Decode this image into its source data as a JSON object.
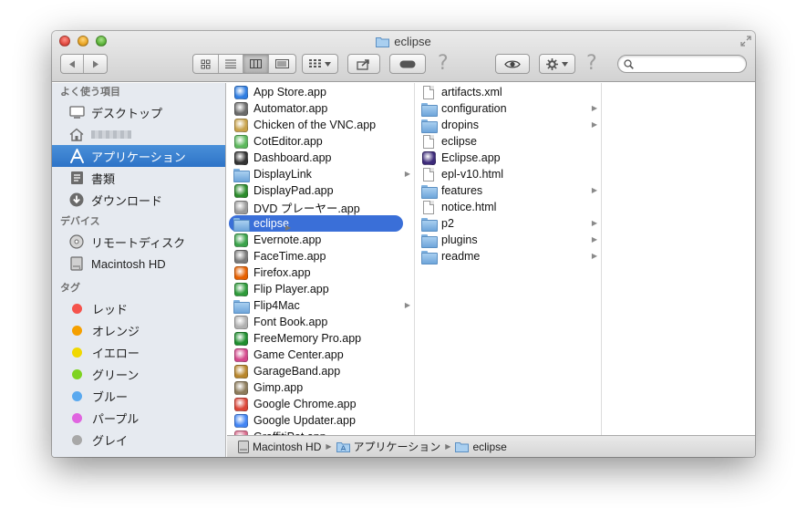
{
  "window": {
    "title": "eclipse"
  },
  "search": {
    "value": "",
    "placeholder": ""
  },
  "sidebar": {
    "sections": [
      {
        "title": "よく使う項目",
        "items": [
          {
            "label": "デスクトップ",
            "icon": "desktop-icon"
          },
          {
            "label": "",
            "icon": "home-icon",
            "blurred": true
          },
          {
            "label": "アプリケーション",
            "icon": "applications-icon",
            "selected": true
          },
          {
            "label": "書類",
            "icon": "documents-icon"
          },
          {
            "label": "ダウンロード",
            "icon": "downloads-icon"
          }
        ]
      },
      {
        "title": "デバイス",
        "items": [
          {
            "label": "リモートディスク",
            "icon": "remote-disc-icon"
          },
          {
            "label": "Macintosh HD",
            "icon": "hard-drive-icon"
          }
        ]
      },
      {
        "title": "タグ",
        "items": [
          {
            "label": "レッド",
            "color": "#f5534c"
          },
          {
            "label": "オレンジ",
            "color": "#f5a000"
          },
          {
            "label": "イエロー",
            "color": "#f0d800"
          },
          {
            "label": "グリーン",
            "color": "#7ed321"
          },
          {
            "label": "ブルー",
            "color": "#5aa9ef"
          },
          {
            "label": "パープル",
            "color": "#e065e0"
          },
          {
            "label": "グレイ",
            "color": "#a8a8a8"
          }
        ]
      }
    ]
  },
  "columns": {
    "applications": [
      {
        "label": "App Store.app",
        "icon": "app-store-icon",
        "color": "#2f7de1"
      },
      {
        "label": "Automator.app",
        "icon": "automator-icon",
        "color": "#6a6a6a"
      },
      {
        "label": "Chicken of the VNC.app",
        "icon": "chicken-vnc-icon",
        "color": "#c8a24a"
      },
      {
        "label": "CotEditor.app",
        "icon": "coteditor-icon",
        "color": "#5cb85c"
      },
      {
        "label": "Dashboard.app",
        "icon": "dashboard-icon",
        "color": "#333333"
      },
      {
        "label": "DisplayLink",
        "icon": "folder-icon",
        "folder": true
      },
      {
        "label": "DisplayPad.app",
        "icon": "displaypad-icon",
        "color": "#2c8c2c"
      },
      {
        "label": "DVD プレーヤー.app",
        "icon": "dvd-player-icon",
        "color": "#9a9a9a"
      },
      {
        "label": "eclipse",
        "icon": "folder-icon",
        "folder": true,
        "selected": true
      },
      {
        "label": "Evernote.app",
        "icon": "evernote-icon",
        "color": "#3aa34a"
      },
      {
        "label": "FaceTime.app",
        "icon": "facetime-icon",
        "color": "#7a7a7a"
      },
      {
        "label": "Firefox.app",
        "icon": "firefox-icon",
        "color": "#e66000"
      },
      {
        "label": "Flip Player.app",
        "icon": "flip-player-icon",
        "color": "#2e9b3a"
      },
      {
        "label": "Flip4Mac",
        "icon": "folder-icon",
        "folder": true
      },
      {
        "label": "Font Book.app",
        "icon": "font-book-icon",
        "color": "#b0b0b0"
      },
      {
        "label": "FreeMemory Pro.app",
        "icon": "freememory-icon",
        "color": "#1f8f2f"
      },
      {
        "label": "Game Center.app",
        "icon": "game-center-icon",
        "color": "#d4488c"
      },
      {
        "label": "GarageBand.app",
        "icon": "garageband-icon",
        "color": "#b8862b"
      },
      {
        "label": "Gimp.app",
        "icon": "gimp-icon",
        "color": "#8c7b5a"
      },
      {
        "label": "Google Chrome.app",
        "icon": "chrome-icon",
        "color": "#db4437"
      },
      {
        "label": "Google Updater.app",
        "icon": "google-updater-icon",
        "color": "#4285f4"
      },
      {
        "label": "GraffitiPot.app",
        "icon": "graffitipot-icon",
        "color": "#d86b8c"
      }
    ],
    "eclipse": [
      {
        "label": "artifacts.xml",
        "icon": "document-icon",
        "doc": true
      },
      {
        "label": "configuration",
        "icon": "folder-icon",
        "folder": true
      },
      {
        "label": "dropins",
        "icon": "folder-icon",
        "folder": true
      },
      {
        "label": "eclipse",
        "icon": "executable-icon",
        "doc": true
      },
      {
        "label": "Eclipse.app",
        "icon": "eclipse-app-icon",
        "color": "#3c2a7a"
      },
      {
        "label": "epl-v10.html",
        "icon": "html-document-icon",
        "doc": true
      },
      {
        "label": "features",
        "icon": "folder-icon",
        "folder": true
      },
      {
        "label": "notice.html",
        "icon": "html-document-icon",
        "doc": true
      },
      {
        "label": "p2",
        "icon": "folder-icon",
        "folder": true
      },
      {
        "label": "plugins",
        "icon": "folder-icon",
        "folder": true
      },
      {
        "label": "readme",
        "icon": "folder-icon",
        "folder": true
      }
    ]
  },
  "pathbar": [
    {
      "label": "Macintosh HD",
      "icon": "hard-drive-icon"
    },
    {
      "label": "アプリケーション",
      "icon": "applications-folder-icon"
    },
    {
      "label": "eclipse",
      "icon": "folder-icon"
    }
  ]
}
